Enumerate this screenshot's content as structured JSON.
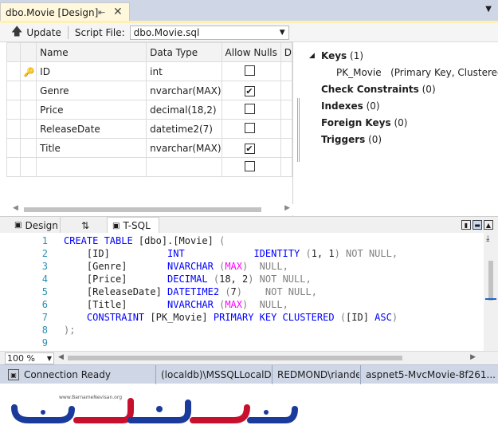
{
  "tab": {
    "title": "dbo.Movie [Design]",
    "pin": "⇤",
    "close": "✕"
  },
  "toolbar": {
    "update_label": "Update",
    "script_file_label": "Script File:",
    "script_file_value": "dbo.Movie.sql"
  },
  "grid": {
    "headers": [
      "Name",
      "Data Type",
      "Allow Nulls",
      "D"
    ],
    "rows": [
      {
        "name": "ID",
        "type": "int",
        "nulls": false,
        "key": true
      },
      {
        "name": "Genre",
        "type": "nvarchar(MAX)",
        "nulls": true,
        "key": false
      },
      {
        "name": "Price",
        "type": "decimal(18,2)",
        "nulls": false,
        "key": false
      },
      {
        "name": "ReleaseDate",
        "type": "datetime2(7)",
        "nulls": false,
        "key": false
      },
      {
        "name": "Title",
        "type": "nvarchar(MAX)",
        "nulls": true,
        "key": false
      },
      {
        "name": "",
        "type": "",
        "nulls": false,
        "key": false
      }
    ]
  },
  "keys": {
    "keys_label": "Keys",
    "keys_count": "(1)",
    "pk_name": "PK_Movie",
    "pk_desc": "(Primary Key, Clustered: I",
    "check_label": "Check Constraints",
    "check_count": "(0)",
    "indexes_label": "Indexes",
    "indexes_count": "(0)",
    "fk_label": "Foreign Keys",
    "fk_count": "(0)",
    "triggers_label": "Triggers",
    "triggers_count": "(0)"
  },
  "midtabs": {
    "design": "Design",
    "swap": "⇅",
    "tsql": "T-SQL"
  },
  "editor": {
    "line_numbers": [
      "1",
      "2",
      "3",
      "4",
      "5",
      "6",
      "7",
      "8",
      "9"
    ]
  },
  "zoom": "100 %",
  "status": {
    "connection": "Connection Ready",
    "server": "(localdb)\\MSSQLLocalDB",
    "user": "REDMOND\\riande",
    "database": "aspnet5-MvcMovie-8f261..."
  },
  "watermark": {
    "site": "www.BarnameNevisan.org"
  },
  "colors": {
    "keyword": "#0000ff",
    "comment": "#808080",
    "function": "#ff00ff",
    "status_bg": "#cfd6e5"
  }
}
